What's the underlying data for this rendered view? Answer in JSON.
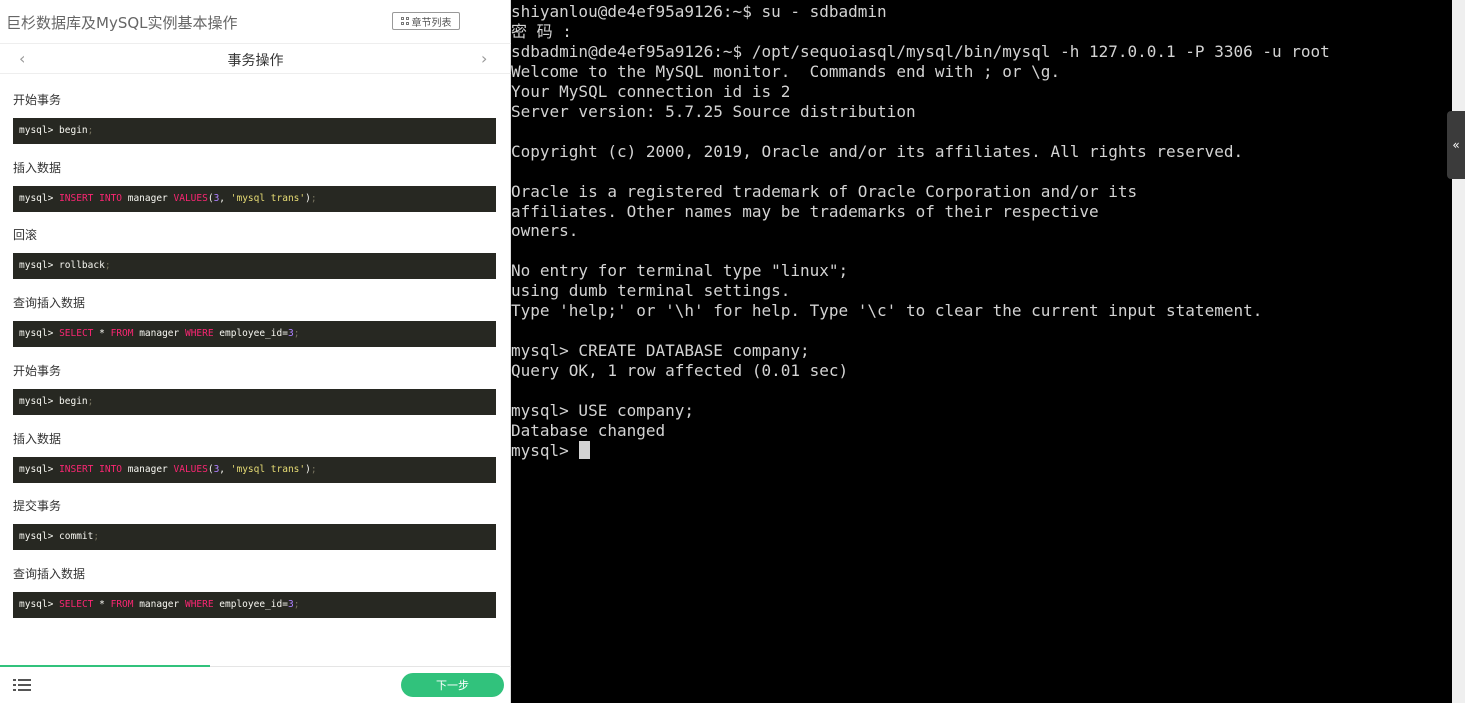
{
  "course": {
    "title": "巨杉数据库及MySQL实例基本操作",
    "chapter_list_label": "章节列表"
  },
  "step": {
    "title": "事务操作",
    "prev_glyph": "‹",
    "next_glyph": "›"
  },
  "sections": [
    {
      "label": "开始事务",
      "prompt": "mysql>",
      "code": " begin;"
    },
    {
      "label": "插入数据",
      "prompt": "mysql>",
      "code": " INSERT INTO manager VALUES(3, 'mysql trans');"
    },
    {
      "label": "回滚",
      "prompt": "mysql>",
      "code": " rollback;"
    },
    {
      "label": "查询插入数据",
      "prompt": "mysql>",
      "code": " SELECT * FROM manager WHERE employee_id=3;"
    },
    {
      "label": "开始事务",
      "prompt": "mysql>",
      "code": " begin;"
    },
    {
      "label": "插入数据",
      "prompt": "mysql>",
      "code": " INSERT INTO manager VALUES(3, 'mysql trans');"
    },
    {
      "label": "提交事务",
      "prompt": "mysql>",
      "code": " commit;"
    },
    {
      "label": "查询插入数据",
      "prompt": "mysql>",
      "code": " SELECT * FROM manager WHERE employee_id=3;"
    }
  ],
  "footer": {
    "next_label": "下一步",
    "progress": 0.41
  },
  "terminal": {
    "lines": [
      "shiyanlou@de4ef95a9126:~$ su - sdbadmin",
      "密 码 :",
      "sdbadmin@de4ef95a9126:~$ /opt/sequoiasql/mysql/bin/mysql -h 127.0.0.1 -P 3306 -u root",
      "Welcome to the MySQL monitor.  Commands end with ; or \\g.",
      "Your MySQL connection id is 2",
      "Server version: 5.7.25 Source distribution",
      "",
      "Copyright (c) 2000, 2019, Oracle and/or its affiliates. All rights reserved.",
      "",
      "Oracle is a registered trademark of Oracle Corporation and/or its",
      "affiliates. Other names may be trademarks of their respective",
      "owners.",
      "",
      "No entry for terminal type \"linux\";",
      "using dumb terminal settings.",
      "Type 'help;' or '\\h' for help. Type '\\c' to clear the current input statement.",
      "",
      "mysql> CREATE DATABASE company;",
      "Query OK, 1 row affected (0.01 sec)",
      "",
      "mysql> USE company;",
      "Database changed",
      "mysql> "
    ],
    "collapse_glyph": "«"
  },
  "colors": {
    "accent": "#31c27c",
    "code_bg": "#272822",
    "terminal_bg": "#000000",
    "terminal_fg": "#d3d3d3"
  }
}
